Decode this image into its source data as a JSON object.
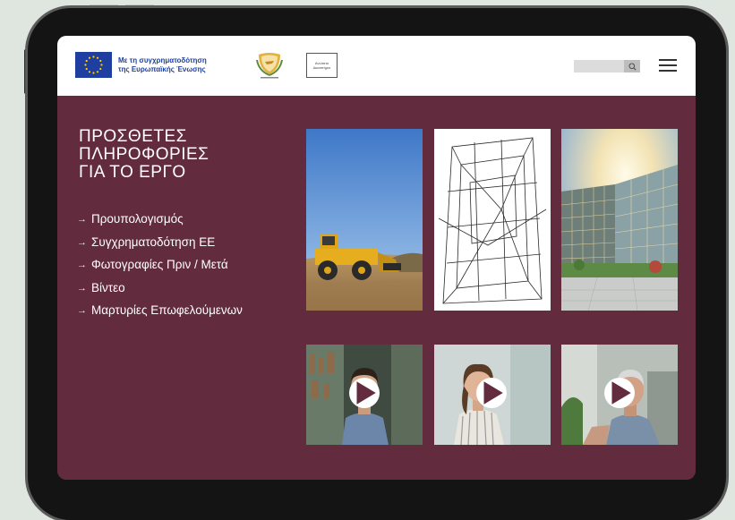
{
  "header": {
    "eu_text_line1": "Με τη συγχρηματοδότηση",
    "eu_text_line2": "της Ευρωπαϊκής Ένωσης",
    "ministry_line1": "Ανώτατο",
    "ministry_line2": "Δικαστήριο",
    "search_placeholder": ""
  },
  "main": {
    "title_line1": "ΠΡΟΣΘΕΤΕΣ",
    "title_line2": "ΠΛΗΡΟΦΟΡΙΕΣ",
    "title_line3": "ΓΙΑ ΤΟ ΕΡΓΟ",
    "links": [
      {
        "label": "Προυπολογισμός"
      },
      {
        "label": "Συγχρηματοδότηση ΕΕ"
      },
      {
        "label": "Φωτογραφίες Πριν / Μετά"
      },
      {
        "label": "Βίντεο"
      },
      {
        "label": "Μαρτυρίες Επωφελούμενων"
      }
    ]
  },
  "colors": {
    "screen_bg": "#622b3e",
    "eu_blue": "#1f3fa0",
    "eu_star": "#ffd200",
    "device": "#141414"
  },
  "icons": [
    "search-icon",
    "hamburger-menu-icon",
    "play-icon",
    "arrow-right-icon"
  ]
}
